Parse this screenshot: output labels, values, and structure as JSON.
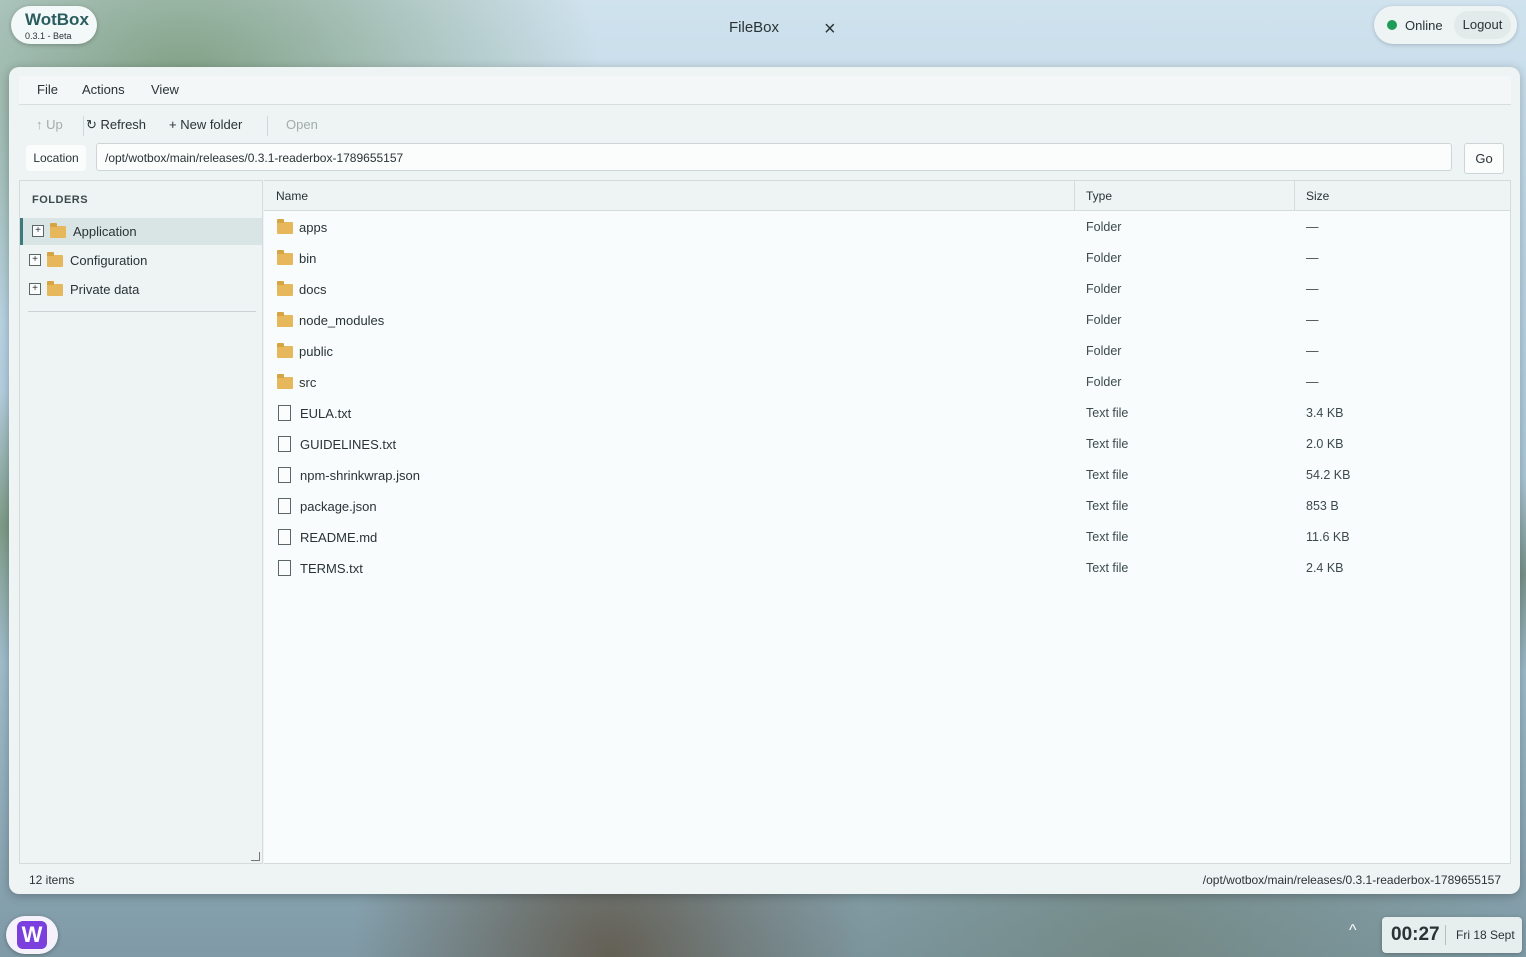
{
  "brand": {
    "name": "WotBox",
    "version": "0.3.1 - Beta"
  },
  "window_title": "FileBox",
  "close_glyph": "×",
  "status": {
    "label": "Online",
    "color": "#1f9d57",
    "logout_label": "Logout"
  },
  "menu": [
    "File",
    "Actions",
    "View"
  ],
  "toolbar": {
    "up_label": "↑ Up",
    "refresh_label": "↻ Refresh",
    "new_folder_label": "+  New folder",
    "open_label": "Open"
  },
  "location": {
    "label": "Location",
    "value": "/opt/wotbox/main/releases/0.3.1-readerbox-1789655157",
    "go_label": "Go"
  },
  "sidebar": {
    "heading": "FOLDERS",
    "items": [
      {
        "label": "Application",
        "selected": true
      },
      {
        "label": "Configuration",
        "selected": false
      },
      {
        "label": "Private data",
        "selected": false
      }
    ]
  },
  "columns": {
    "name": "Name",
    "type": "Type",
    "size": "Size"
  },
  "files": [
    {
      "name": "apps",
      "type": "Folder",
      "size": "—",
      "kind": "folder"
    },
    {
      "name": "bin",
      "type": "Folder",
      "size": "—",
      "kind": "folder"
    },
    {
      "name": "docs",
      "type": "Folder",
      "size": "—",
      "kind": "folder"
    },
    {
      "name": "node_modules",
      "type": "Folder",
      "size": "—",
      "kind": "folder"
    },
    {
      "name": "public",
      "type": "Folder",
      "size": "—",
      "kind": "folder"
    },
    {
      "name": "src",
      "type": "Folder",
      "size": "—",
      "kind": "folder"
    },
    {
      "name": "EULA.txt",
      "type": "Text file",
      "size": "3.4 KB",
      "kind": "file"
    },
    {
      "name": "GUIDELINES.txt",
      "type": "Text file",
      "size": "2.0 KB",
      "kind": "file"
    },
    {
      "name": "npm-shrinkwrap.json",
      "type": "Text file",
      "size": "54.2 KB",
      "kind": "file"
    },
    {
      "name": "package.json",
      "type": "Text file",
      "size": "853 B",
      "kind": "file"
    },
    {
      "name": "README.md",
      "type": "Text file",
      "size": "11.6 KB",
      "kind": "file"
    },
    {
      "name": "TERMS.txt",
      "type": "Text file",
      "size": "2.4 KB",
      "kind": "file"
    }
  ],
  "statusbar": {
    "count": "12 items",
    "path": "/opt/wotbox/main/releases/0.3.1-readerbox-1789655157"
  },
  "taskbar": {
    "launcher_glyph": "W",
    "tray_caret": "^",
    "time": "00:27",
    "date": "Fri 18 Sept"
  },
  "colors": {
    "accent": "#3e7a7c",
    "folder": "#e7b85b",
    "launcher": "#7a3fdc"
  }
}
